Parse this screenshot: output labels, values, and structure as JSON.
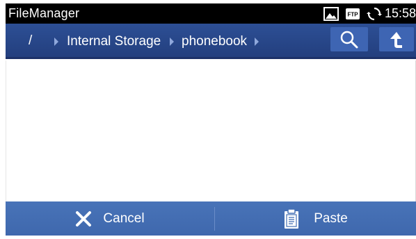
{
  "status_bar": {
    "app_title": "FileManager",
    "ftp_badge": "FTP",
    "time": "15:58",
    "icons": [
      "image-icon",
      "ftp-icon",
      "sync-icon"
    ]
  },
  "toolbar": {
    "breadcrumb": [
      {
        "label": "/"
      },
      {
        "label": "Internal Storage"
      },
      {
        "label": "phonebook"
      }
    ],
    "buttons": [
      "search-icon",
      "up-arrow-icon"
    ]
  },
  "bottom_bar": {
    "cancel_label": "Cancel",
    "paste_label": "Paste"
  },
  "colors": {
    "toolbar": "#2a4a8c",
    "toolbar_button": "#3e65b3",
    "bottom_bar": "#4570b5",
    "status_bar": "#000000"
  }
}
